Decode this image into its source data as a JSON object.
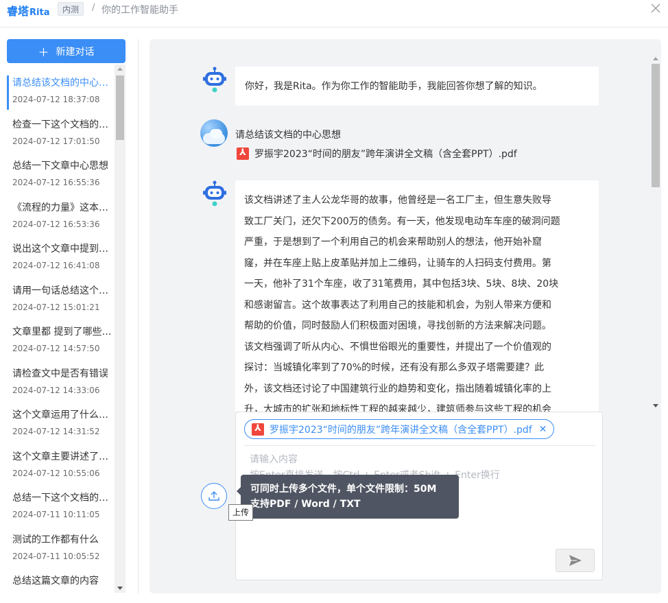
{
  "header": {
    "brand_cn": "睿塔",
    "brand_en": "Rita",
    "tag": "内测",
    "separator": "/",
    "subtitle": "你的工作智能助手"
  },
  "sidebar": {
    "new_chat_label": "新建对话",
    "conversations": [
      {
        "title": "请总结该文档的中心思想",
        "time": "2024-07-12 18:37:08"
      },
      {
        "title": "检查一下这个文档的内容",
        "time": "2024-07-12 17:01:50"
      },
      {
        "title": "总结一下文章中心思想",
        "time": "2024-07-12 16:55:36"
      },
      {
        "title": "《流程的力量》这本书讲了什么",
        "time": "2024-07-12 16:53:36"
      },
      {
        "title": "说出这个文章中提到的内容",
        "time": "2024-07-12 16:41:08"
      },
      {
        "title": "请用一句话总结这个文档",
        "time": "2024-07-12 15:01:21"
      },
      {
        "title": "文章里都 提到了哪些内容",
        "time": "2024-07-12 14:57:50"
      },
      {
        "title": "请检查文中是否有错误",
        "time": "2024-07-12 14:33:06"
      },
      {
        "title": "这个文章运用了什么手法",
        "time": "2024-07-12 14:31:52"
      },
      {
        "title": "这个文章主要讲述了什么",
        "time": "2024-07-12 10:55:06"
      },
      {
        "title": "总结一下这个文档的内容",
        "time": "2024-07-11 10:11:05"
      },
      {
        "title": "测试的工作都有什么",
        "time": "2024-07-11 10:05:52"
      },
      {
        "title": "总结这篇文章的内容",
        "time": ""
      }
    ]
  },
  "chat": {
    "greeting": "你好，我是Rita。作为你工作的智能助手，我能回答你想了解的知识。",
    "user_question": "请总结该文档的中心思想",
    "user_file": "罗振宇2023“时间的朋友”跨年演讲全文稿（含全套PPT）.pdf",
    "answer_lines": [
      "该文档讲述了主人公龙华哥的故事，他曾经是一名工厂主，但生意失败导",
      "致工厂关门，还欠下200万的债务。有一天，他发现电动车车座的破洞问题",
      "严重，于是想到了一个利用自己的机会来帮助别人的想法，他开始补窟",
      "窿，并在车座上贴上皮革贴并加上二维码，让骑车的人扫码支付费用。第",
      "一天，他补了31个车座，收了31笔费用，其中包括3块、5块、8块、20块",
      "和感谢留言。这个故事表达了利用自己的技能和机会，为别人带来方便和",
      "帮助的价值，同时鼓励人们积极面对困境，寻找创新的方法来解决问题。",
      "该文档强调了听从内心、不惧世俗眼光的重要性，并提出了一个价值观的",
      "探讨：当城镇化率到了70%的时候，还有没有那么多双子塔需要建？此",
      "外，该文档还讨论了中国建筑行业的趋势和变化，指出随着城镇化率的上",
      "升，大城市的扩张和地标性工程的越来越少，建筑师参与这些工程的机会"
    ]
  },
  "input": {
    "attached_file": "罗振宇2023“时间的朋友”跨年演讲全文稿（含全套PPT）.pdf",
    "placeholder_line1": "请输入内容",
    "placeholder_line2": "按Enter直接发送，按Ctrl + Enter或者Shift + Enter换行",
    "upload_label": "上传",
    "tooltip_line1": "可同时上传多个文件，单个文件限制：50M",
    "tooltip_line2": "支持PDF / Word / TXT"
  },
  "colors": {
    "accent": "#3b8ef5",
    "pdf_red": "#f0463c",
    "tooltip_bg": "#4f5562"
  },
  "icons": [
    "close-icon",
    "plus-icon",
    "robot-icon",
    "pdf-icon",
    "upload-icon",
    "send-icon"
  ]
}
